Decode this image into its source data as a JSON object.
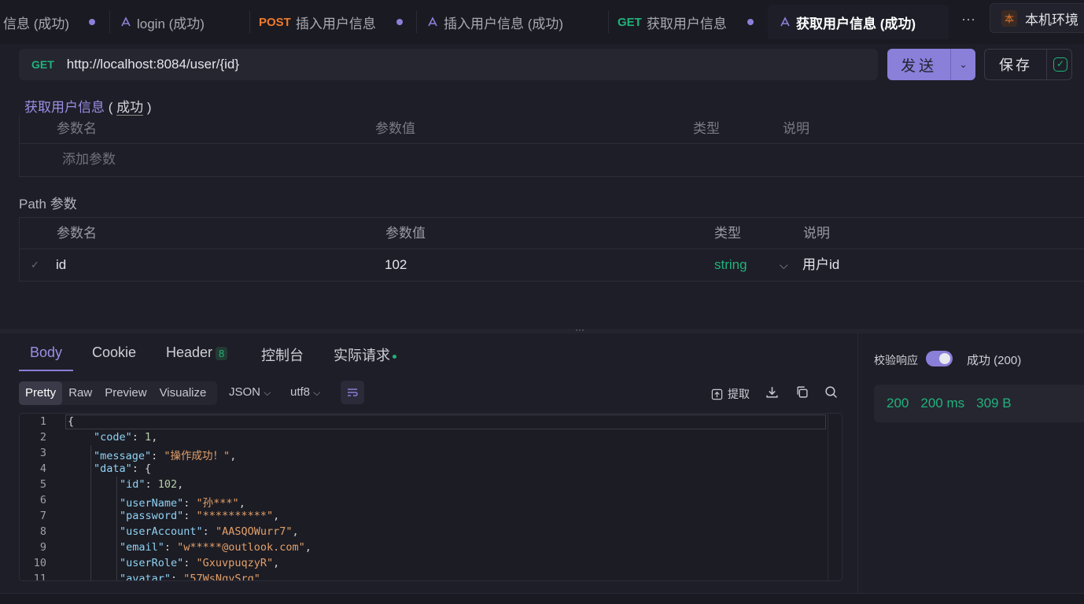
{
  "tabs": [
    {
      "method": "",
      "label": "信息 (成功)",
      "dirty": true
    },
    {
      "method": "",
      "label": "login (成功)",
      "dirty": false
    },
    {
      "method": "POST",
      "label": "插入用户信息",
      "dirty": true
    },
    {
      "method": "",
      "label": "插入用户信息 (成功)",
      "dirty": false
    },
    {
      "method": "GET",
      "label": "获取用户信息",
      "dirty": true
    },
    {
      "method": "",
      "label": "获取用户信息 (成功)",
      "dirty": false
    }
  ],
  "more_label": "···",
  "env": {
    "badge": "本",
    "label": "本机环境"
  },
  "request": {
    "method": "GET",
    "url": "http://localhost:8084/user/{id}",
    "send_label": "发送",
    "save_label": "保存",
    "breadcrumb_name": "获取用户信息",
    "breadcrumb_status": "成功"
  },
  "query_table": {
    "headers": [
      "参数名",
      "参数值",
      "类型",
      "说明"
    ],
    "add_placeholder": "添加参数"
  },
  "path_section": {
    "title": "Path 参数",
    "headers": [
      "参数名",
      "参数值",
      "类型",
      "说明"
    ],
    "rows": [
      {
        "name": "id",
        "value": "102",
        "type": "string",
        "desc": "用户id"
      }
    ]
  },
  "response": {
    "tabs": {
      "body": "Body",
      "cookie": "Cookie",
      "header": "Header",
      "header_count": "8",
      "console": "控制台",
      "actual": "实际请求"
    },
    "view_modes": [
      "Pretty",
      "Raw",
      "Preview",
      "Visualize"
    ],
    "format": "JSON",
    "encoding": "utf8",
    "extract_label": "提取",
    "validate_label": "校验响应",
    "result_label": "成功 (200)",
    "status_code": "200",
    "time": "200 ms",
    "size": "309 B",
    "line_numbers": [
      "1",
      "2",
      "3",
      "4",
      "5",
      "6",
      "7",
      "8",
      "9",
      "10",
      "11"
    ],
    "body": [
      {
        "indent": 0,
        "key": "",
        "val": "{",
        "type": "p"
      },
      {
        "indent": 1,
        "key": "\"code\"",
        "val": "1",
        "type": "n",
        "comma": true
      },
      {
        "indent": 1,
        "key": "\"message\"",
        "val": "\"操作成功！\"",
        "type": "s",
        "comma": true
      },
      {
        "indent": 1,
        "key": "\"data\"",
        "val": "{",
        "type": "p"
      },
      {
        "indent": 2,
        "key": "\"id\"",
        "val": "102",
        "type": "n",
        "comma": true
      },
      {
        "indent": 2,
        "key": "\"userName\"",
        "val": "\"孙***\"",
        "type": "s",
        "comma": true
      },
      {
        "indent": 2,
        "key": "\"password\"",
        "val": "\"**********\"",
        "type": "s",
        "comma": true
      },
      {
        "indent": 2,
        "key": "\"userAccount\"",
        "val": "\"AASQOWurr7\"",
        "type": "s",
        "comma": true
      },
      {
        "indent": 2,
        "key": "\"email\"",
        "val": "\"w*****@outlook.com\"",
        "type": "s",
        "comma": true
      },
      {
        "indent": 2,
        "key": "\"userRole\"",
        "val": "\"GxuvpuqzyR\"",
        "type": "s",
        "comma": true
      },
      {
        "indent": 2,
        "key": "\"avatar\"",
        "val": "\"57WsNqySrq\"",
        "type": "s",
        "comma": true
      }
    ]
  }
}
